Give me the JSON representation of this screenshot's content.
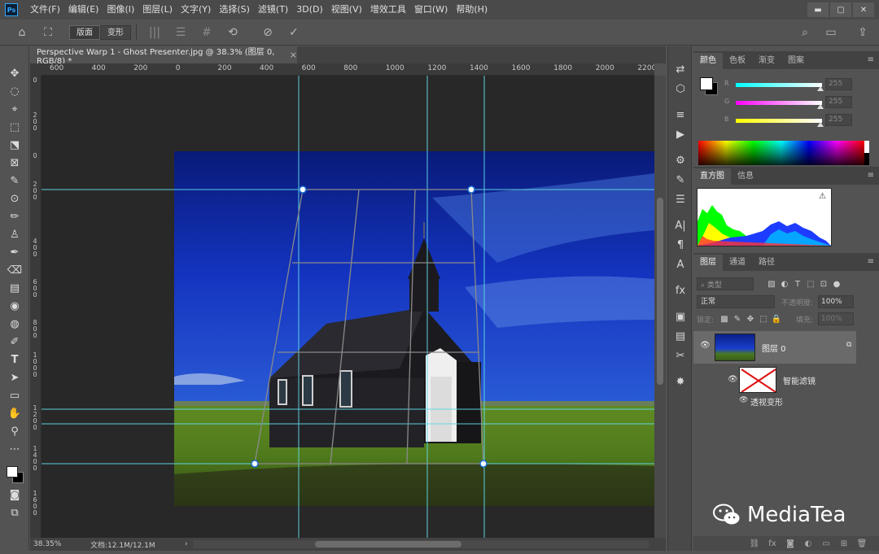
{
  "app": {
    "logo": "Ps"
  },
  "menu": [
    "文件(F)",
    "编辑(E)",
    "图像(I)",
    "图层(L)",
    "文字(Y)",
    "选择(S)",
    "滤镜(T)",
    "3D(D)",
    "视图(V)",
    "增效工具",
    "窗口(W)",
    "帮助(H)"
  ],
  "window_controls": {
    "minimize": "▬",
    "maximize": "▢",
    "close": "✕"
  },
  "options": {
    "home_icon": "⌂",
    "warp_icon": "⛶",
    "mode_layout": "版面",
    "mode_warp": "变形",
    "vertical_icon": "|||",
    "horizontal_icon": "☰",
    "grid_icon": "#",
    "reset_icon": "⟲",
    "cancel_icon": "⊘",
    "commit_icon": "✓",
    "search_icon": "⌕",
    "workspace_icon": "▭",
    "share_icon": "⇪"
  },
  "document": {
    "tab_title": "Perspective Warp 1 - Ghost Presenter.jpg @ 38.3% (图层 0, RGB/8) *",
    "tab_close": "×",
    "zoom": "38.35%",
    "doc_size": "文档:12.1M/12.1M",
    "status_arrow": "›",
    "h_ruler": [
      "600",
      "400",
      "200",
      "0",
      "200",
      "400",
      "600",
      "800",
      "1000",
      "1200",
      "1400",
      "1600",
      "1800",
      "2000",
      "2200"
    ],
    "v_ruler": [
      "0",
      "2 0 0",
      "0",
      "2 0 0",
      "4 0 0",
      "6 0 0",
      "8 0 0",
      "1 0 0 0",
      "1 2 0 0",
      "1 4 0 0",
      "1 6 0 0"
    ]
  },
  "tools": [
    "✥",
    "◌",
    "⌖",
    "⬚",
    "⬔",
    "⊠",
    "✎",
    "⊙",
    "✏",
    "♙",
    "✒",
    "⌫",
    "▤",
    "◉",
    "◍",
    "✐",
    "T",
    "➤",
    "▭",
    "✋",
    "⚲",
    "⋯"
  ],
  "icon_strip": [
    "⇄",
    "⬡",
    "≡",
    "▶",
    "⚙",
    "✎",
    "☰",
    "A|",
    "¶",
    "A",
    "fx",
    "▣",
    "▤",
    "✂",
    "✸"
  ],
  "color_panel": {
    "tabs": [
      "颜色",
      "色板",
      "渐变",
      "图案"
    ],
    "r_label": "R",
    "g_label": "G",
    "b_label": "B",
    "r_value": "255",
    "g_value": "255",
    "b_value": "255",
    "menu": "≡"
  },
  "histogram_panel": {
    "tabs": [
      "直方图",
      "信息"
    ],
    "warning_icon": "⚠",
    "menu": "≡"
  },
  "layers_panel": {
    "tabs": [
      "图层",
      "通道",
      "路径"
    ],
    "menu": "≡",
    "kind_filter": "⌕ 类型",
    "filter_icons": [
      "▨",
      "◐",
      "T",
      "⬚",
      "⊡",
      "●"
    ],
    "blend_mode": "正常",
    "opacity_label": "不透明度:",
    "opacity_value": "100%",
    "lock_label": "锁定:",
    "lock_icons": [
      "▩",
      "✎",
      "✥",
      "⬚",
      "🔒"
    ],
    "fill_label": "填充:",
    "fill_value": "100%",
    "layer_name": "图层 0",
    "smart_filters": "智能滤镜",
    "filter_name": "透视变形",
    "eye_icon": "👁",
    "footer_icons": [
      "⛓",
      "fx",
      "◙",
      "◐",
      "▭",
      "⊞",
      "🗑"
    ]
  },
  "watermark": "MediaTea"
}
